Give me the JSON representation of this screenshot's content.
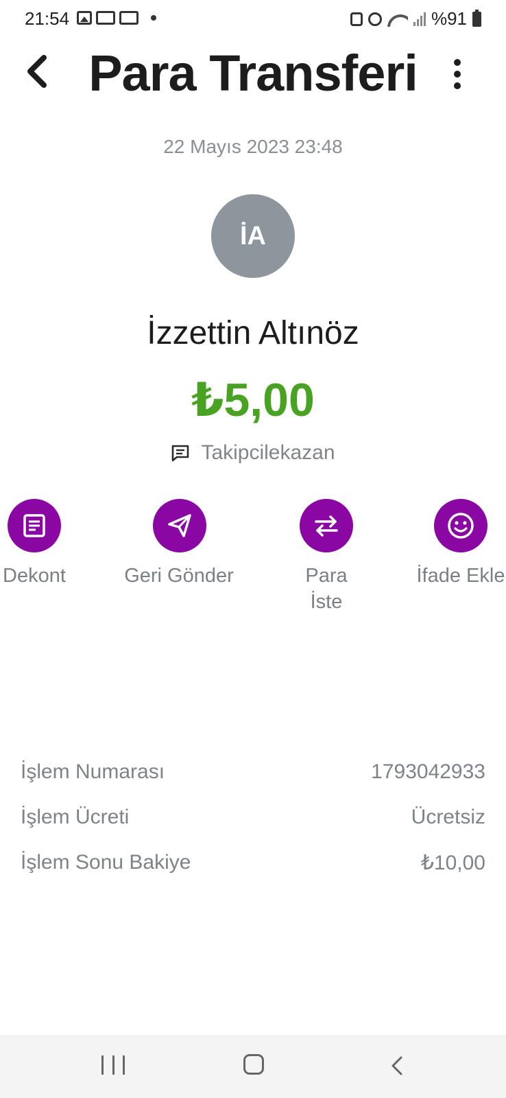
{
  "status_bar": {
    "time": "21:54",
    "battery_text": "%91",
    "icons": [
      "gallery-icon",
      "camera-notification-icon",
      "camera-notification-icon",
      "dot-icon",
      "recycle-icon",
      "alarm-icon",
      "wifi-icon",
      "signal-icon",
      "battery-icon"
    ]
  },
  "header": {
    "title": "Para Transferi",
    "back_icon": "chevron-left-icon",
    "menu_icon": "more-vertical-icon"
  },
  "transaction": {
    "date": "22 Mayıs 2023 23:48",
    "avatar_initials": "İA",
    "recipient_name": "İzzettin Altınöz",
    "amount": "₺5,00",
    "note_icon": "message-icon",
    "note": "Takipcilekazan"
  },
  "actions": [
    {
      "label": "Dekont",
      "icon": "receipt-icon"
    },
    {
      "label": "Geri Gönder",
      "icon": "send-icon"
    },
    {
      "label_line1": "Para",
      "label_line2": "İste",
      "icon": "swap-arrows-icon"
    },
    {
      "label": "İfade Ekle",
      "icon": "smiley-icon"
    }
  ],
  "details": [
    {
      "label": "İşlem Numarası",
      "value": "1793042933"
    },
    {
      "label": "İşlem Ücreti",
      "value": "Ücretsiz"
    },
    {
      "label": "İşlem Sonu Bakiye",
      "value": "₺10,00"
    }
  ],
  "colors": {
    "accent_purple": "#8a07a3",
    "amount_green": "#4aa222",
    "avatar_gray": "#8e969d",
    "secondary_text": "#7d838a"
  },
  "nav_bar": {
    "icons": [
      "recent-apps-icon",
      "home-icon",
      "back-icon"
    ]
  }
}
